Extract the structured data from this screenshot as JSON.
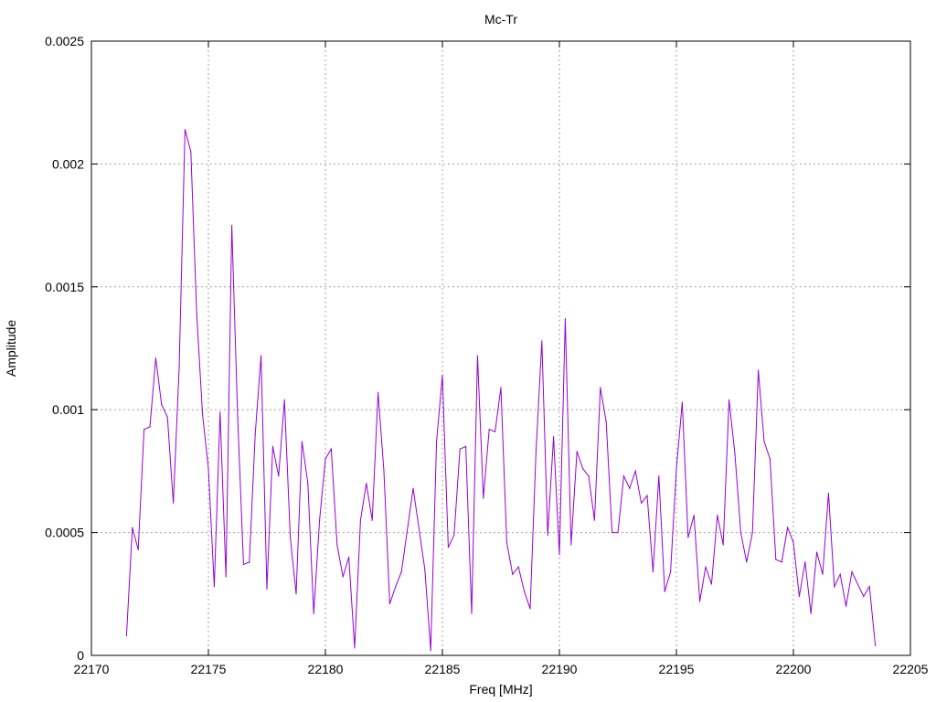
{
  "chart_data": {
    "type": "line",
    "title": "Mc-Tr",
    "xlabel": "Freq [MHz]",
    "ylabel": "Amplitude",
    "xlim": [
      22170,
      22205
    ],
    "ylim": [
      0,
      0.0025
    ],
    "xticks": [
      "22170",
      "22175",
      "22180",
      "22185",
      "22190",
      "22195",
      "22200",
      "22205"
    ],
    "yticks": [
      "0",
      "0.0005",
      "0.001",
      "0.0015",
      "0.002",
      "0.0025"
    ],
    "grid": true,
    "legend": "none",
    "series": [
      {
        "color": "#9400d3",
        "points": [
          [
            22171.5,
            8e-05
          ],
          [
            22171.75,
            0.00052
          ],
          [
            22172.0,
            0.00043
          ],
          [
            22172.25,
            0.00092
          ],
          [
            22172.5,
            0.00093
          ],
          [
            22172.75,
            0.00121
          ],
          [
            22173.0,
            0.00102
          ],
          [
            22173.25,
            0.00097
          ],
          [
            22173.5,
            0.00062
          ],
          [
            22173.75,
            0.00117
          ],
          [
            22174.0,
            0.00214
          ],
          [
            22174.25,
            0.00205
          ],
          [
            22174.5,
            0.00139
          ],
          [
            22174.75,
            0.00098
          ],
          [
            22175.0,
            0.00076
          ],
          [
            22175.25,
            0.00028
          ],
          [
            22175.5,
            0.00099
          ],
          [
            22175.75,
            0.00032
          ],
          [
            22176.0,
            0.00175
          ],
          [
            22176.25,
            0.00097
          ],
          [
            22176.5,
            0.00037
          ],
          [
            22176.75,
            0.00038
          ],
          [
            22177.0,
            0.0009
          ],
          [
            22177.25,
            0.00122
          ],
          [
            22177.5,
            0.00027
          ],
          [
            22177.75,
            0.00085
          ],
          [
            22178.0,
            0.00073
          ],
          [
            22178.25,
            0.00104
          ],
          [
            22178.5,
            0.00048
          ],
          [
            22178.75,
            0.00025
          ],
          [
            22179.0,
            0.00087
          ],
          [
            22179.25,
            0.0007
          ],
          [
            22179.5,
            0.00017
          ],
          [
            22179.75,
            0.00055
          ],
          [
            22180.0,
            0.0008
          ],
          [
            22180.25,
            0.00084
          ],
          [
            22180.5,
            0.00045
          ],
          [
            22180.75,
            0.00032
          ],
          [
            22181.0,
            0.0004
          ],
          [
            22181.25,
            3e-05
          ],
          [
            22181.5,
            0.00055
          ],
          [
            22181.75,
            0.0007
          ],
          [
            22182.0,
            0.00055
          ],
          [
            22182.25,
            0.00107
          ],
          [
            22182.5,
            0.00075
          ],
          [
            22182.75,
            0.00021
          ],
          [
            22183.0,
            0.00028
          ],
          [
            22183.25,
            0.00034
          ],
          [
            22183.75,
            0.00068
          ],
          [
            22184.25,
            0.00035
          ],
          [
            22184.5,
            2e-05
          ],
          [
            22184.75,
            0.00087
          ],
          [
            22185.0,
            0.00114
          ],
          [
            22185.25,
            0.00044
          ],
          [
            22185.5,
            0.00049
          ],
          [
            22185.75,
            0.00084
          ],
          [
            22186.0,
            0.00085
          ],
          [
            22186.25,
            0.00017
          ],
          [
            22186.5,
            0.00122
          ],
          [
            22186.75,
            0.00064
          ],
          [
            22187.0,
            0.00092
          ],
          [
            22187.25,
            0.00091
          ],
          [
            22187.5,
            0.00109
          ],
          [
            22187.75,
            0.00046
          ],
          [
            22188.0,
            0.00033
          ],
          [
            22188.25,
            0.00036
          ],
          [
            22188.5,
            0.00026
          ],
          [
            22188.75,
            0.00019
          ],
          [
            22189.0,
            0.00083
          ],
          [
            22189.25,
            0.00128
          ],
          [
            22189.5,
            0.00049
          ],
          [
            22189.75,
            0.00089
          ],
          [
            22190.0,
            0.00041
          ],
          [
            22190.25,
            0.00137
          ],
          [
            22190.5,
            0.00045
          ],
          [
            22190.75,
            0.00083
          ],
          [
            22191.0,
            0.00076
          ],
          [
            22191.25,
            0.00073
          ],
          [
            22191.5,
            0.00055
          ],
          [
            22191.75,
            0.00109
          ],
          [
            22192.0,
            0.00095
          ],
          [
            22192.25,
            0.0005
          ],
          [
            22192.5,
            0.0005
          ],
          [
            22192.75,
            0.00073
          ],
          [
            22193.0,
            0.00068
          ],
          [
            22193.25,
            0.00075
          ],
          [
            22193.5,
            0.00062
          ],
          [
            22193.75,
            0.00065
          ],
          [
            22194.0,
            0.00034
          ],
          [
            22194.25,
            0.00073
          ],
          [
            22194.5,
            0.00026
          ],
          [
            22194.75,
            0.00034
          ],
          [
            22195.0,
            0.00076
          ],
          [
            22195.25,
            0.00103
          ],
          [
            22195.5,
            0.00048
          ],
          [
            22195.75,
            0.00057
          ],
          [
            22196.0,
            0.00022
          ],
          [
            22196.25,
            0.00036
          ],
          [
            22196.5,
            0.00029
          ],
          [
            22196.75,
            0.00057
          ],
          [
            22197.0,
            0.00045
          ],
          [
            22197.25,
            0.00104
          ],
          [
            22197.5,
            0.00082
          ],
          [
            22197.75,
            0.0005
          ],
          [
            22198.0,
            0.00038
          ],
          [
            22198.25,
            0.0005
          ],
          [
            22198.5,
            0.00116
          ],
          [
            22198.75,
            0.00087
          ],
          [
            22199.0,
            0.0008
          ],
          [
            22199.25,
            0.00039
          ],
          [
            22199.5,
            0.00038
          ],
          [
            22199.75,
            0.00052
          ],
          [
            22200.0,
            0.00046
          ],
          [
            22200.25,
            0.00024
          ],
          [
            22200.5,
            0.00038
          ],
          [
            22200.75,
            0.00017
          ],
          [
            22201.0,
            0.00042
          ],
          [
            22201.25,
            0.00033
          ],
          [
            22201.5,
            0.00066
          ],
          [
            22201.75,
            0.00028
          ],
          [
            22202.0,
            0.00033
          ],
          [
            22202.25,
            0.0002
          ],
          [
            22202.5,
            0.00034
          ],
          [
            22202.75,
            0.00029
          ],
          [
            22203.0,
            0.00024
          ],
          [
            22203.25,
            0.00028
          ],
          [
            22203.5,
            4e-05
          ]
        ]
      }
    ]
  }
}
